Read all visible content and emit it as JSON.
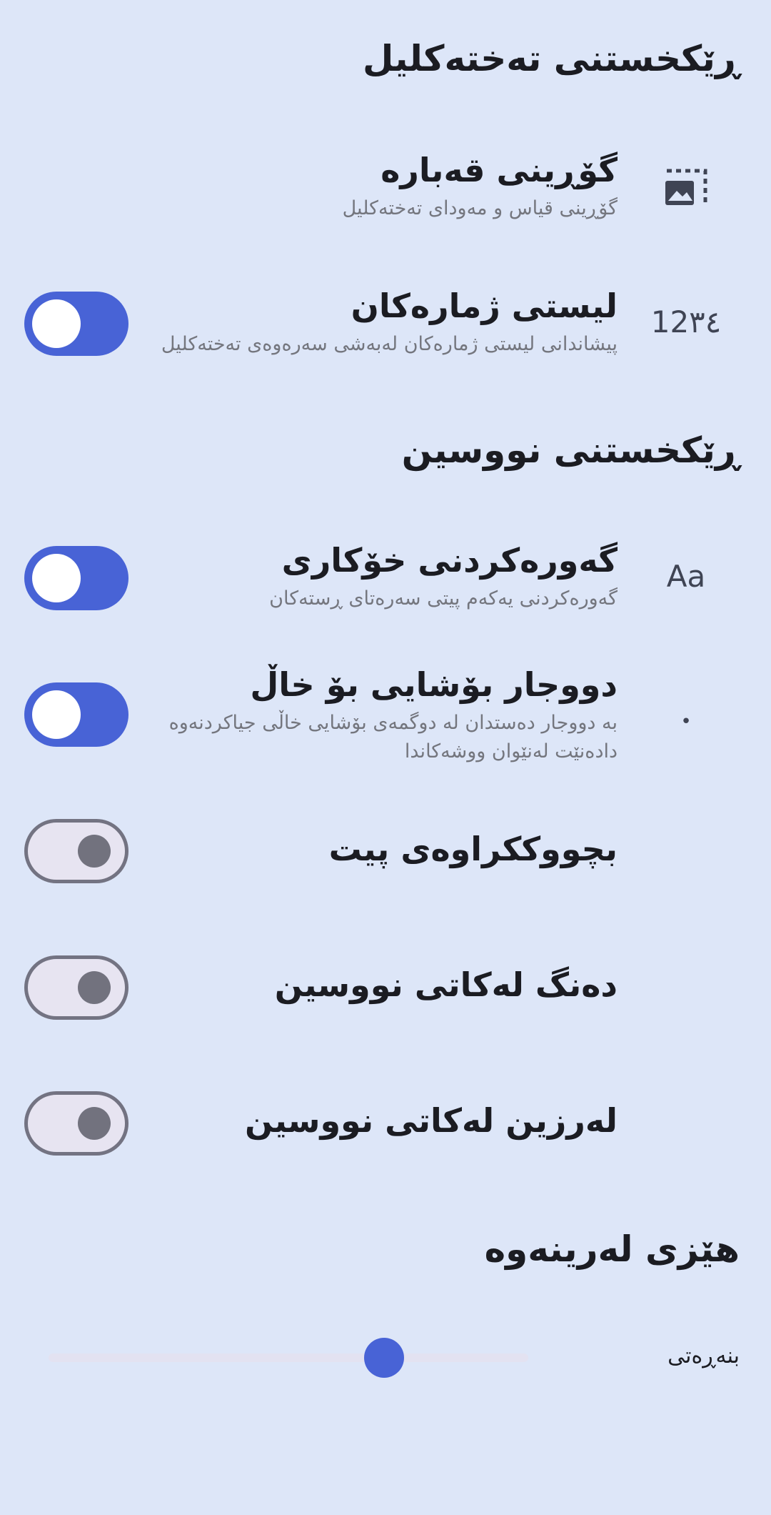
{
  "sections": {
    "keyboard_settings": {
      "title": "ڕێکخستنی تەختەکلیل",
      "resize": {
        "title": "گۆڕینی قەبارە",
        "subtitle": "گۆڕینی قیاس و مەودای تەختەکلیل",
        "icon": "resize-image-icon"
      },
      "number_row": {
        "title": "لیستی ژمارەکان",
        "subtitle": "پیشاندانی لیستی ژمارەکان لەبەشی سەرەوەی تەختەکلیل",
        "icon_text": "12٣٤",
        "enabled": true
      }
    },
    "writing_settings": {
      "title": "ڕێکخستنی نووسین",
      "auto_capitalize": {
        "title": "گەورەکردنی خۆکاری",
        "subtitle": "گەورەکردنی یەکەم پیتی سەرەتای ڕستەکان",
        "icon_text": "Aa",
        "enabled": true
      },
      "double_space": {
        "title": "دووجار بۆشایی بۆ خاڵ",
        "subtitle": "بە دووجار دەستدان لە دوگمەی بۆشایی خاڵی جیاکردنەوە دادەنێت لەنێوان ووشەکاندا",
        "icon_text": "•",
        "enabled": true
      },
      "key_popup": {
        "title": "بچووککراوەی پیت",
        "enabled": false
      },
      "sound": {
        "title": "دەنگ لەکاتی نووسین",
        "enabled": false
      },
      "vibration": {
        "title": "لەرزین لەکاتی نووسین",
        "enabled": false
      }
    },
    "vibration_strength": {
      "title": "هێزی لەرینەوە",
      "slider_label": "بنەڕەتی",
      "slider_value_fraction": 0.7
    }
  },
  "colors": {
    "background": "#dde6f8",
    "accent": "#4863d6",
    "toggle_off_border": "#737382",
    "subtitle": "#74767e"
  }
}
